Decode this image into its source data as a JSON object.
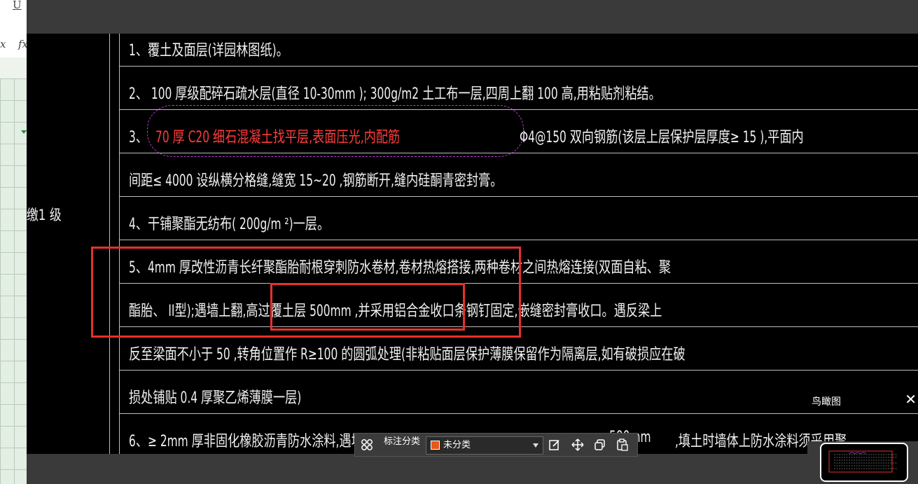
{
  "left_panel": {
    "symbol_u": "U",
    "symbol_x": "x",
    "symbol_fx": "fx"
  },
  "side_label": "缴1 级",
  "rows": [
    "1、覆土及面层(详园林图纸)。",
    "2、 100  厚级配碎石疏水层(直径        10-30mm       );  300g/m2      土工布一层,四周上翻        100  高,用粘贴剂粘结。",
    "3、",
    "70  厚 C20  细石混凝土找平层,表面压光,内配筋",
    "Φ4@150   双向钢筋(该层上层保护层厚度≥               15  ),平面内",
    "间距≤ 4000   设纵横分格缝,缝宽        15~20   ,钢筋断开,缝内硅酮青密封膏。",
    "4、干铺聚酯无纺布(        200g/m    ²)一层。",
    "5、4mm   厚改性沥青长纤聚酯胎耐根穿刺防水卷材,卷材热熔搭接,两种卷材之间热熔连接(双面自粘、聚",
    "酯胎、 II型);遇墙上翻,高过覆土层             500mm      ,并采用铝合金收口条钢钉固定,嵌缝密封膏收口。遇反梁上",
    "反至梁面不小于       50  ,转角位置作       R≥100   的圆弧处理(非粘贴面层保护薄膜保留作为隔离层,如有破损应在破",
    "损处铺贴  0.4  厚聚乙烯薄膜一层)",
    "6、≥ 2mm   厚非固化橡胶沥青防水涂料,遇墙上翻,高过覆土层",
    "500mm",
    ",填土时墙体上防水涂料须采用聚"
  ],
  "toolbar": {
    "category_label": "标注分类",
    "category_value": "未分类",
    "category_color": "#e35a1b"
  },
  "birdseye": {
    "title": "鸟瞰图",
    "close": "✕"
  },
  "colors": {
    "annotation_red": "#e8302a",
    "cloud": "#c03ad8",
    "cad_bg": "#000000"
  }
}
